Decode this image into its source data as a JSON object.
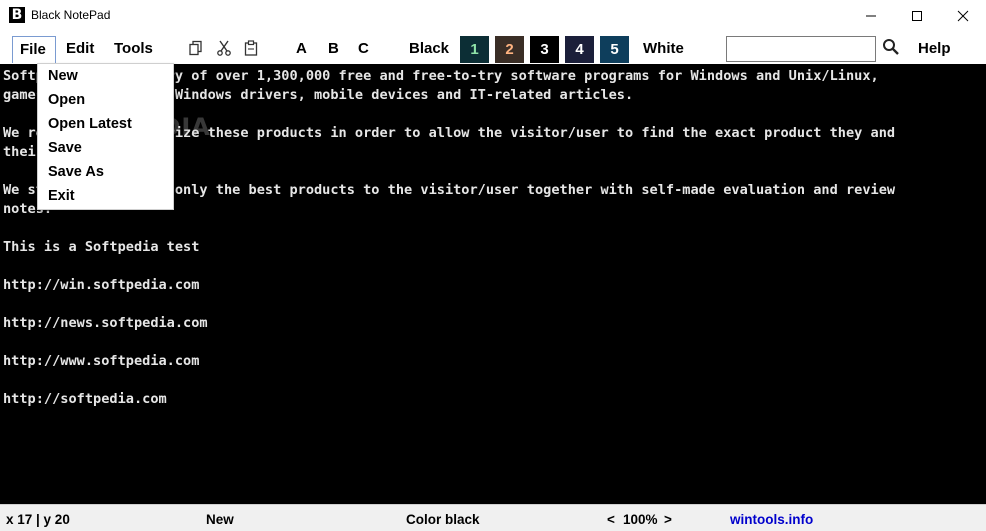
{
  "window": {
    "title": "Black NotePad",
    "icon_letter": "B"
  },
  "menu": {
    "file": "File",
    "edit": "Edit",
    "tools": "Tools"
  },
  "toolbar": {
    "icons": [
      "copy-icon",
      "cut-icon",
      "paste-icon"
    ],
    "fonts": [
      "A",
      "B",
      "C"
    ],
    "theme_black_label": "Black",
    "theme_white_label": "White",
    "themes": [
      {
        "label": "1",
        "bg": "#0c2e35",
        "fg": "#8fe3a8"
      },
      {
        "label": "2",
        "bg": "#3a2e26",
        "fg": "#ffb380"
      },
      {
        "label": "3",
        "bg": "#000000",
        "fg": "#ffffff"
      },
      {
        "label": "4",
        "bg": "#1b1f3a",
        "fg": "#ffffff"
      },
      {
        "label": "5",
        "bg": "#0e3e5c",
        "fg": "#ffffff"
      }
    ],
    "search_value": "",
    "help": "Help"
  },
  "file_menu": {
    "items": [
      "New",
      "Open",
      "Open Latest",
      "Save",
      "Save As",
      "Exit"
    ]
  },
  "editor": {
    "lines": [
      "Softpedia is a library of over 1,300,000 free and free-to-try software programs for Windows and Unix/Linux,",
      "games, Mac software, Windows drivers, mobile devices and IT-related articles.",
      "",
      "We review and categorize these products in order to allow the visitor/user to find the exact product they and",
      "their system needs.",
      "",
      "We strive to deliver only the best products to the visitor/user together with self-made evaluation and review",
      "notes.",
      "",
      "This is a Softpedia test",
      "",
      "http://win.softpedia.com",
      "",
      "http://news.softpedia.com",
      "",
      "http://www.softpedia.com",
      "",
      "http://softpedia.com"
    ]
  },
  "watermark": "SOFTPEDIA",
  "status": {
    "position": "x 17 | y 20",
    "doc_state": "New",
    "color": "Color black",
    "zoom_prev": "<",
    "zoom": "100%",
    "zoom_next": ">",
    "site": "wintools.info"
  },
  "colors": {
    "editor_bg": "#000000",
    "editor_text": "#e6e6e6",
    "link": "#0000cc",
    "menu_border": "#7a9bd1"
  }
}
